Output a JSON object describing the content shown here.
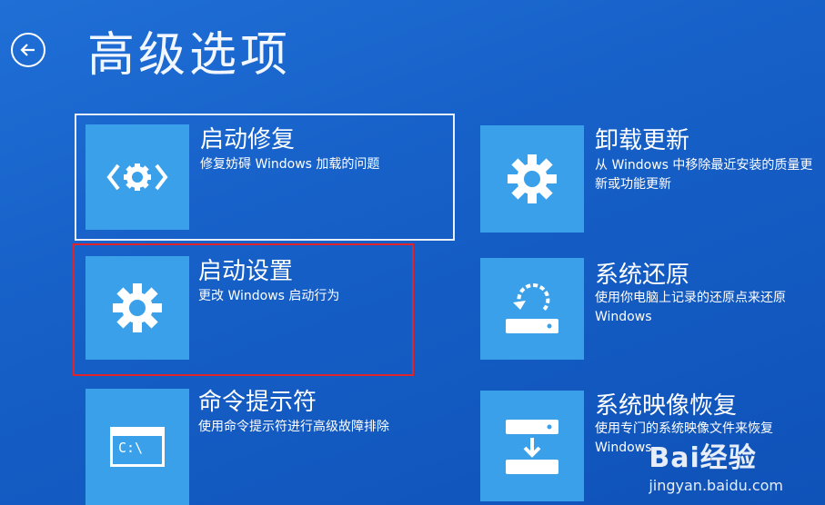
{
  "page": {
    "title": "高级选项"
  },
  "colors": {
    "background": "#1660c8",
    "tile": "#3aa0ea",
    "highlight": "#e0242a"
  },
  "options": [
    {
      "title": "启动修复",
      "desc": "修复妨碍 Windows 加载的问题",
      "icon": "code-gear-icon"
    },
    {
      "title": "启动设置",
      "desc": "更改 Windows 启动行为",
      "icon": "gear-icon"
    },
    {
      "title": "命令提示符",
      "desc": "使用命令提示符进行高级故障排除",
      "icon": "command-prompt-icon",
      "tile_text": "C:\\"
    },
    {
      "title": "卸载更新",
      "desc": "从 Windows 中移除最近安装的质量更新或功能更新",
      "icon": "gear-icon"
    },
    {
      "title": "系统还原",
      "desc": "使用你电脑上记录的还原点来还原 Windows",
      "icon": "restore-icon"
    },
    {
      "title": "系统映像恢复",
      "desc": "使用专门的系统映像文件来恢复 Windows",
      "icon": "image-recovery-icon"
    }
  ],
  "watermark": {
    "brand": "Bai经验",
    "url": "jingyan.baidu.com"
  }
}
